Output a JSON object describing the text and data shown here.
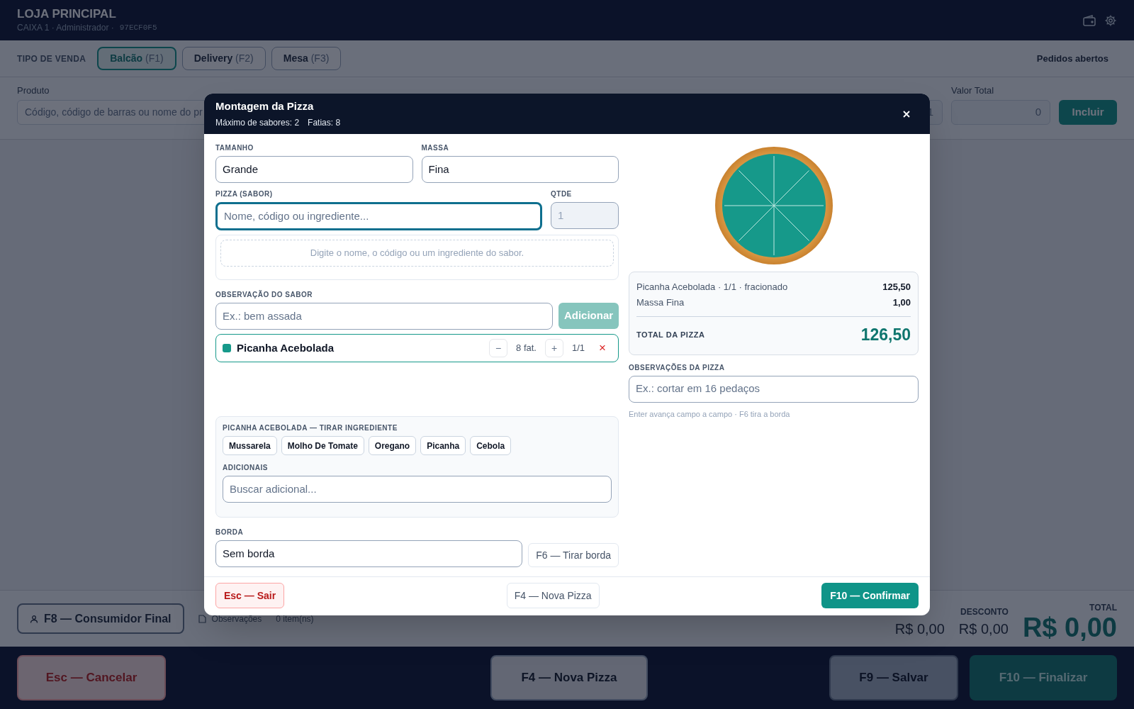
{
  "header": {
    "store": "LOJA PRINCIPAL",
    "subtitle": "CAIXA 1 · Administrador ·",
    "terminal_code": "97ECF0F5"
  },
  "sale_type": {
    "label": "TIPO DE VENDA",
    "tabs": [
      {
        "label": "Balcão",
        "shortcut": "(F1)",
        "selected": true
      },
      {
        "label": "Delivery",
        "shortcut": "(F2)",
        "selected": false
      },
      {
        "label": "Mesa",
        "shortcut": "(F3)",
        "selected": false
      }
    ],
    "open_orders": "Pedidos abertos"
  },
  "product_entry": {
    "label": "Produto",
    "placeholder": "Código, código de barras ou nome do pr",
    "quantity": "1",
    "total_label": "Valor Total",
    "total_value": "0",
    "add_button": "Incluir"
  },
  "summary": {
    "consumer_button": "F8 — Consumidor Final",
    "notes_link": "Observações",
    "item_count": "0 item(ns)",
    "subtotal_value": "R$ 0,00",
    "discount_label": "DESCONTO",
    "discount_value": "R$ 0,00",
    "total_label": "TOTAL",
    "total_value": "R$ 0,00"
  },
  "actions": [
    {
      "label": "Esc — Cancelar",
      "kind": "danger"
    },
    {
      "label": "F4 — Nova Pizza",
      "kind": "neutral"
    },
    {
      "label": "F9 — Salvar",
      "kind": "dark"
    },
    {
      "label": "F10 — Finalizar",
      "kind": "primary"
    }
  ],
  "modal": {
    "title": "Montagem da Pizza",
    "max_flavors": "Máximo de sabores: 2",
    "slices": "Fatias: 8",
    "size": {
      "label": "TAMANHO",
      "value": "Grande"
    },
    "crust": {
      "label": "MASSA",
      "value": "Fina"
    },
    "flavor_search": {
      "label": "PIZZA (SABOR)",
      "placeholder": "Nome, código ou ingrediente...",
      "focused": true
    },
    "quantity": {
      "label": "QTDE",
      "placeholder": "1"
    },
    "search_hint": "Digite o nome, o código ou um ingrediente do sabor.",
    "flavor_note": {
      "label": "OBSERVAÇÃO DO SABOR",
      "placeholder": "Ex.: bem assada",
      "button": "Adicionar"
    },
    "flavors": [
      {
        "name": "Picanha Acebolada",
        "color": "#16998a",
        "minus": "−",
        "slices": "8 fat.",
        "plus": "+",
        "fraction": "1/1",
        "remove": "×"
      }
    ],
    "remove_ingredients": {
      "title": "PICANHA ACEBOLADA — TIRAR INGREDIENTE",
      "ingredients": [
        "Mussarela",
        "Molho De Tomate",
        "Oregano",
        "Picanha",
        "Cebola"
      ]
    },
    "extras": {
      "label": "ADICIONAIS",
      "placeholder": "Buscar adicional..."
    },
    "border": {
      "label": "BORDA",
      "value": "Sem borda",
      "button": "F6 — Tirar borda"
    },
    "price_lines": [
      {
        "label": "Picanha Acebolada · 1/1 · fracionado",
        "value": "125,50"
      },
      {
        "label": "Massa Fina",
        "value": "1,00"
      }
    ],
    "total_label": "TOTAL DA PIZZA",
    "total_value": "126,50",
    "pizza_notes": {
      "label": "OBSERVAÇÕES DA PIZZA",
      "placeholder": "Ex.: cortar em 16 pedaços"
    },
    "hint": "Enter avança campo a campo · F6 tira a borda",
    "footer_buttons": [
      {
        "label": "Esc — Sair",
        "kind": "danger"
      },
      {
        "label": "F4 — Nova Pizza",
        "kind": "neutral"
      },
      {
        "label": "F10 — Confirmar",
        "kind": "primary"
      }
    ]
  }
}
